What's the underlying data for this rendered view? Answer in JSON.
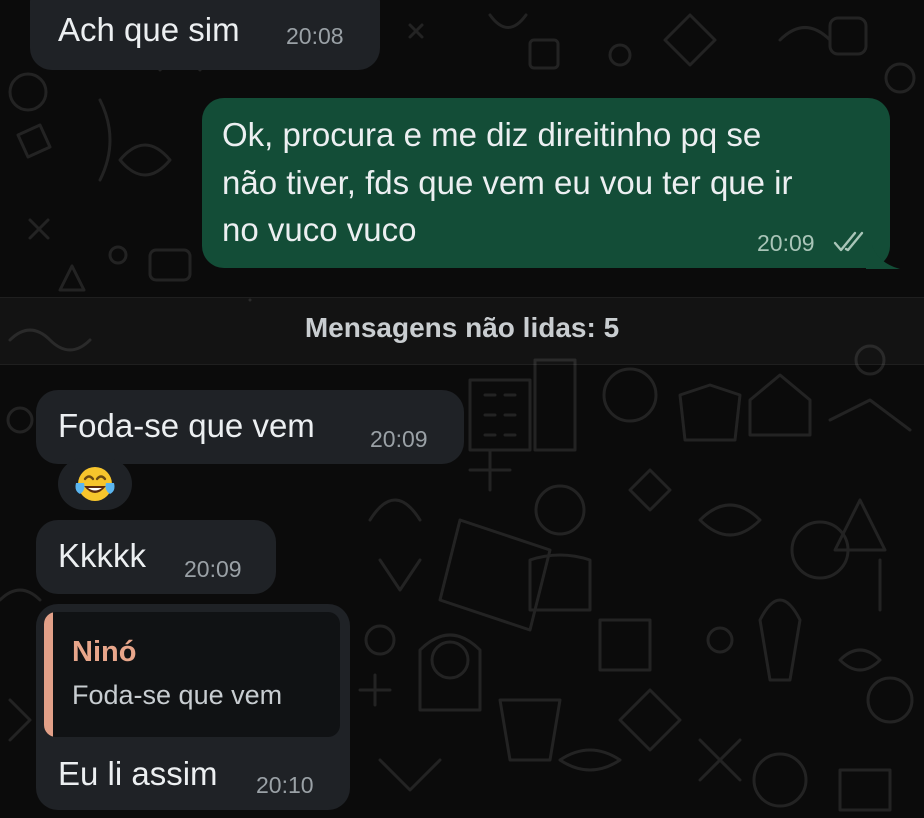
{
  "chat": {
    "messages": [
      {
        "type": "incoming",
        "text": "Ach que sim",
        "time": "20:08"
      },
      {
        "type": "outgoing",
        "lines": [
          "Ok, procura e me diz direitinho pq se",
          "não tiver, fds que vem eu vou ter que ir",
          "no vuco vuco"
        ],
        "time": "20:09",
        "status": "read"
      },
      {
        "type": "unread-divider",
        "text": "Mensagens não lidas: 5"
      },
      {
        "type": "incoming",
        "text": "Foda-se que vem",
        "time": "20:09"
      },
      {
        "type": "incoming-emoji",
        "emoji": "😂"
      },
      {
        "type": "incoming",
        "text": "Kkkkk",
        "time": "20:09"
      },
      {
        "type": "incoming-reply",
        "quote": {
          "author": "Ninó",
          "text": "Foda-se que vem"
        },
        "text": "Eu li assim",
        "time": "20:10"
      }
    ]
  },
  "icons": {
    "read_receipt": "double-check-icon",
    "wallpaper": "doodle-pattern"
  },
  "colors": {
    "background": "#0b0b0b",
    "incoming_bubble": "#1f2226",
    "outgoing_bubble": "#134d37",
    "reply_author": "#e8a68b",
    "read_receipt": "#a9c5b8"
  }
}
